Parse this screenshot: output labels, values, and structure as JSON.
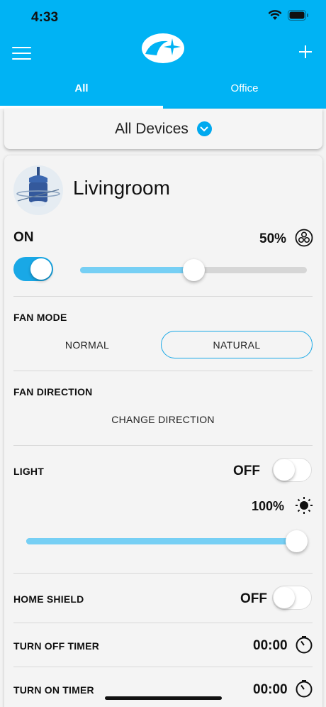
{
  "status_bar": {
    "time": "4:33"
  },
  "header": {
    "tabs": [
      {
        "label": "All",
        "active": true
      },
      {
        "label": "Office",
        "active": false
      }
    ],
    "accent_color": "#00b3f4"
  },
  "selector": {
    "label": "All Devices"
  },
  "device": {
    "name": "Livingroom",
    "power_label": "ON",
    "power_on": true,
    "speed_percent": "50%",
    "speed_value": 0.5,
    "fan_mode": {
      "title": "FAN MODE",
      "options": [
        "NORMAL",
        "NATURAL"
      ],
      "selected": "NATURAL"
    },
    "fan_direction": {
      "title": "FAN DIRECTION",
      "action": "CHANGE DIRECTION"
    },
    "light": {
      "title": "LIGHT",
      "state": "OFF",
      "brightness_percent": "100%",
      "brightness_value": 1.0
    },
    "home_shield": {
      "title": "HOME SHIELD",
      "state": "OFF"
    },
    "turn_off_timer": {
      "title": "TURN OFF TIMER",
      "value": "00:00"
    },
    "turn_on_timer": {
      "title": "TURN ON TIMER",
      "value": "00:00"
    }
  }
}
